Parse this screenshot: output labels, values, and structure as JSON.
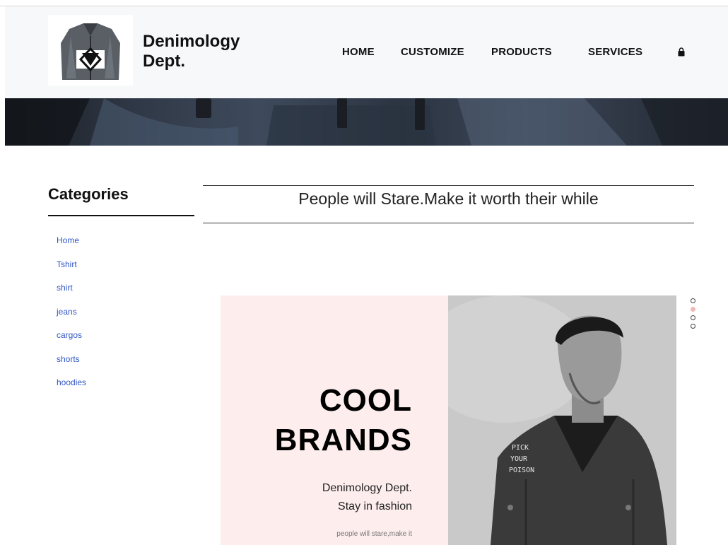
{
  "brand": {
    "line1": "Denimology",
    "line2": "Dept."
  },
  "nav": {
    "home": "HOME",
    "customize": "CUSTOMIZE",
    "products": "PRODUCTS",
    "services": "SERVICES"
  },
  "sidebar": {
    "title": "Categories",
    "items": [
      "Home",
      "Tshirt",
      "shirt",
      "jeans",
      "cargos",
      "shorts",
      "hoodies"
    ]
  },
  "tagline": "People will Stare.Make it worth their while",
  "slide": {
    "heading1": "COOL",
    "heading2": "BRANDS",
    "sub1": "Denimology Dept.",
    "sub2": "Stay in fashion",
    "small": "people will stare,make it",
    "jacket_text": [
      "PICK",
      "YOUR",
      "POISON"
    ]
  },
  "carousel": {
    "count": 4,
    "active": 2
  },
  "icons": {
    "cart": "shopping-bag-icon"
  },
  "colors": {
    "link": "#2f56c6",
    "slide_bg": "#fdeeed",
    "dot_active": "#f1b8b6"
  }
}
